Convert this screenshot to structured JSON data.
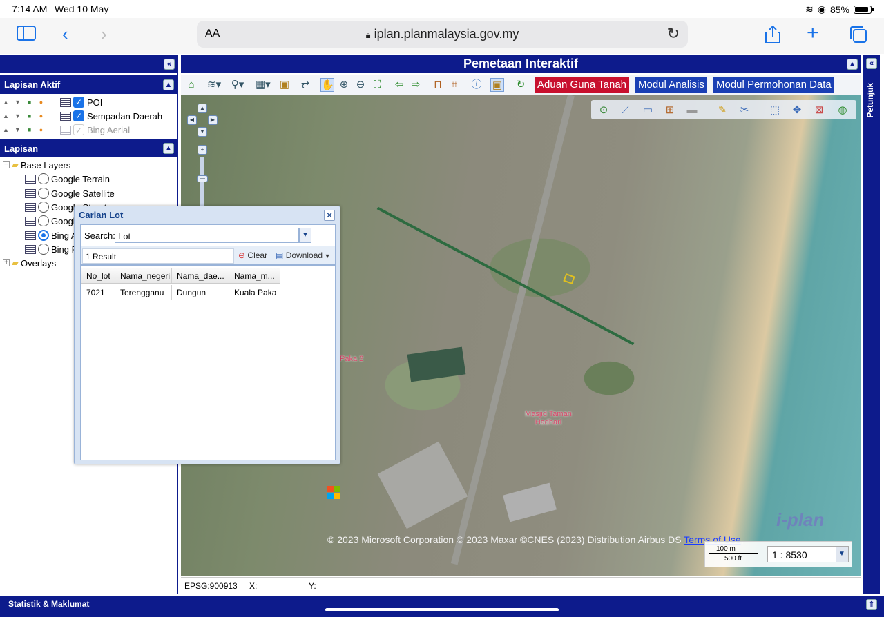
{
  "status_bar": {
    "time": "7:14 AM",
    "date": "Wed 10 May",
    "battery": "85%"
  },
  "browser": {
    "font_size_label": "AA",
    "url": "iplan.planmalaysia.gov.my"
  },
  "active_layers": {
    "title": "Lapisan Aktif",
    "items": [
      {
        "label": "POI",
        "checked": true
      },
      {
        "label": "Sempadan Daerah",
        "checked": true
      },
      {
        "label": "Bing Aerial",
        "checked": false
      }
    ]
  },
  "layers": {
    "title": "Lapisan",
    "base_group": "Base Layers",
    "base_items": [
      "Google Terrain",
      "Google Satellite",
      "Google Streets",
      "Google",
      "Bing A",
      "Bing R"
    ],
    "selected_base": "Bing A",
    "overlay_group": "Overlays"
  },
  "map": {
    "title": "Pemetaan Interaktif",
    "buttons": [
      "Aduan Guna Tanah",
      "Modul Analisis",
      "Modul Permohonan Data"
    ],
    "button_colors": [
      "#c8102e",
      "#1a3fb4",
      "#1a3fb4"
    ],
    "labels": [
      "Paka 2",
      "Masjid Taman Hadhari"
    ],
    "attribution": "© 2023 Microsoft Corporation © 2023 Maxar ©CNES (2023) Distribution Airbus DS",
    "terms_link": "Terms of Use",
    "scale_m": "100 m",
    "scale_ft": "500 ft",
    "scale_ratio": "1 : 8530",
    "projection": "EPSG:900913",
    "x_label": "X:",
    "y_label": "Y:",
    "brand": "i-plan"
  },
  "dialog": {
    "title": "Carian Lot",
    "search_label": "Search:",
    "search_value": "Lot",
    "result_count": "1 Result",
    "clear_label": "Clear",
    "download_label": "Download",
    "columns": [
      "No_lot",
      "Nama_negeri",
      "Nama_dae...",
      "Nama_m..."
    ],
    "rows": [
      [
        "7021",
        "Terengganu",
        "Dungun",
        "Kuala Paka"
      ]
    ]
  },
  "right_rail_label": "Petunjuk",
  "bottom_bar_label": "Statistik & Maklumat"
}
